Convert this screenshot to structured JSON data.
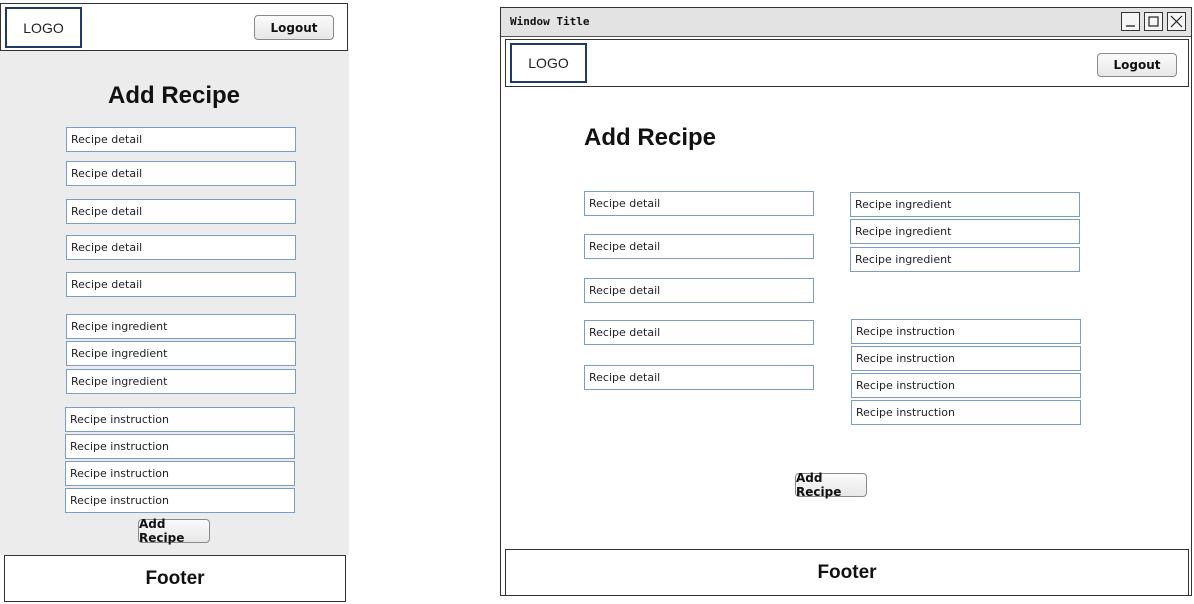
{
  "mobile": {
    "logo": "LOGO",
    "logout_label": "Logout",
    "title": "Add Recipe",
    "details": [
      "Recipe detail",
      "Recipe detail",
      "Recipe detail",
      "Recipe detail",
      "Recipe detail"
    ],
    "ingredients": [
      "Recipe ingredient",
      "Recipe ingredient",
      "Recipe ingredient"
    ],
    "instructions": [
      "Recipe instruction",
      "Recipe instruction",
      "Recipe instruction",
      "Recipe instruction"
    ],
    "add_label": "Add Recipe",
    "footer": "Footer"
  },
  "desktop": {
    "window_title": "Window Title",
    "logo": "LOGO",
    "logout_label": "Logout",
    "title": "Add Recipe",
    "details": [
      "Recipe detail",
      "Recipe detail",
      "Recipe detail",
      "Recipe detail",
      "Recipe detail"
    ],
    "ingredients": [
      "Recipe ingredient",
      "Recipe ingredient",
      "Recipe ingredient"
    ],
    "instructions": [
      "Recipe instruction",
      "Recipe instruction",
      "Recipe instruction",
      "Recipe instruction"
    ],
    "add_label": "Add Recipe",
    "footer": "Footer",
    "window_controls": [
      "minimize-icon",
      "maximize-icon",
      "close-icon"
    ]
  }
}
